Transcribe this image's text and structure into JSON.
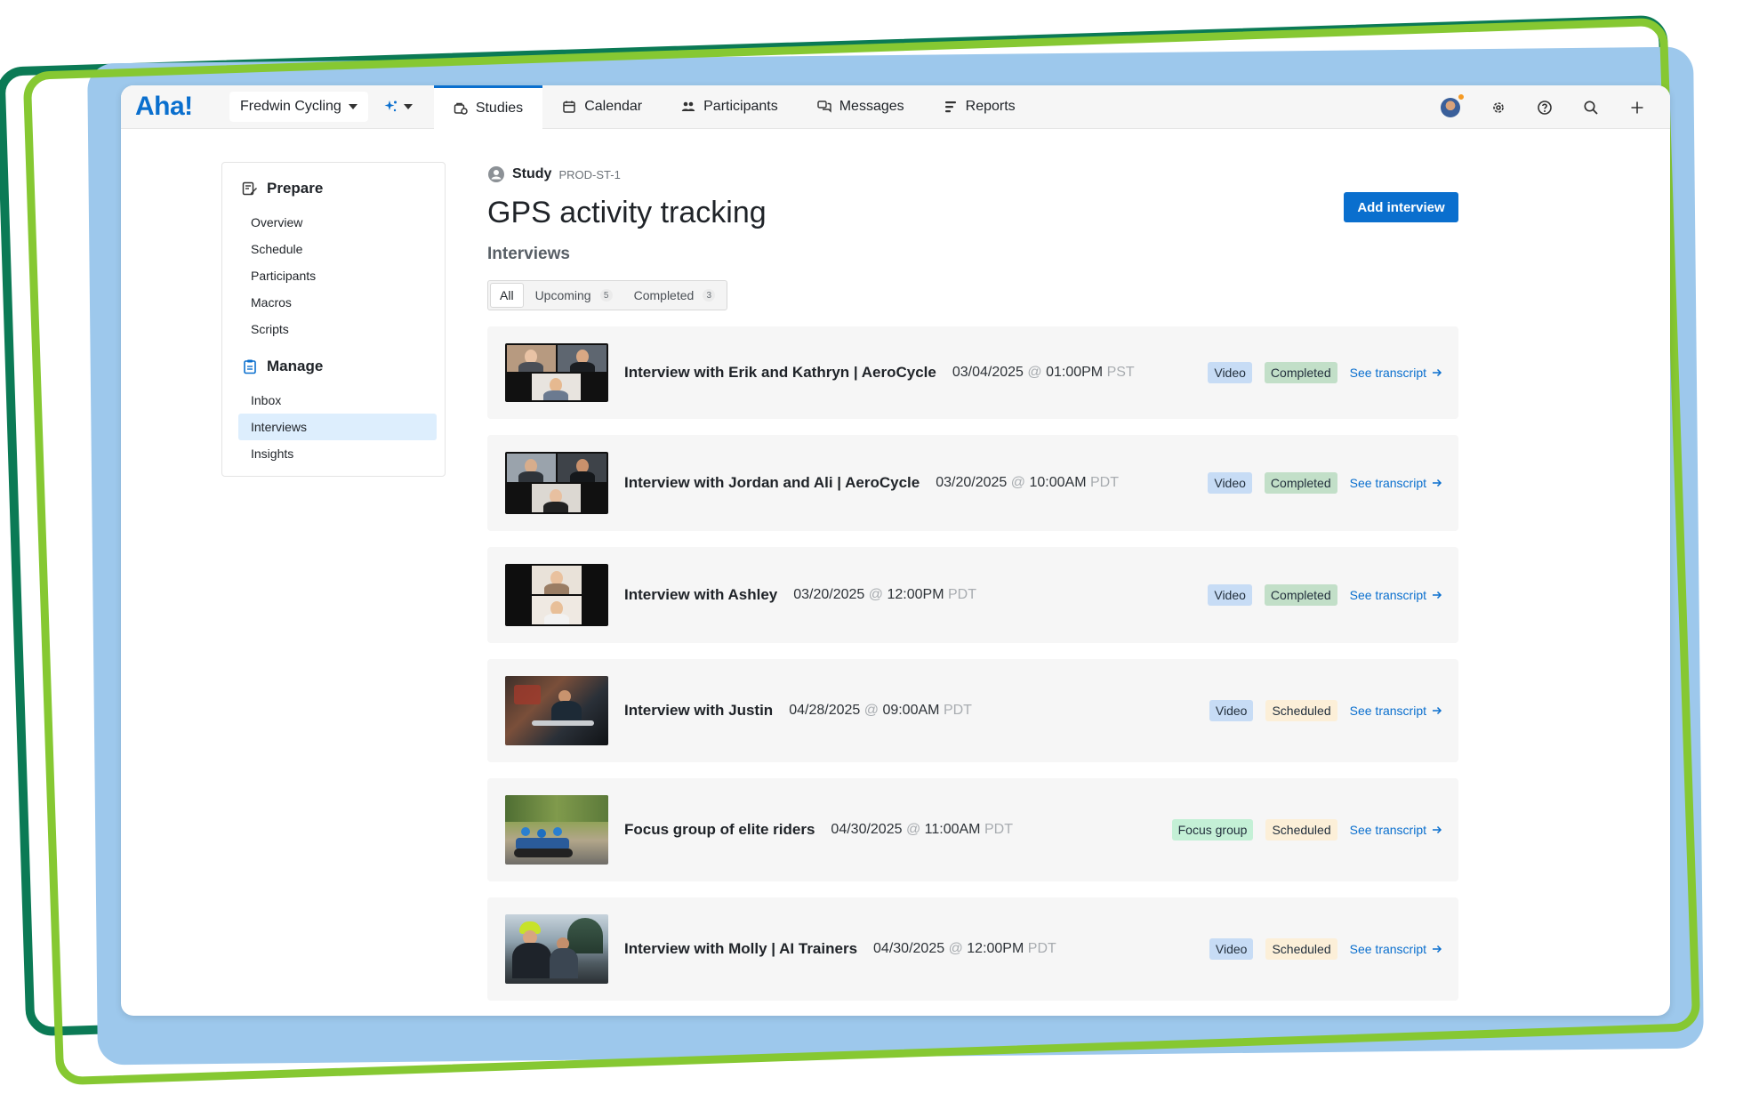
{
  "app": {
    "logo": "Aha!",
    "workspace": "Fredwin Cycling",
    "nav_tabs": [
      {
        "label": "Studies",
        "icon": "studies-icon",
        "active": true
      },
      {
        "label": "Calendar",
        "icon": "calendar-icon",
        "active": false
      },
      {
        "label": "Participants",
        "icon": "participants-icon",
        "active": false
      },
      {
        "label": "Messages",
        "icon": "messages-icon",
        "active": false
      },
      {
        "label": "Reports",
        "icon": "reports-icon",
        "active": false
      }
    ],
    "right_icons": [
      "avatar",
      "gear-icon",
      "help-icon",
      "search-icon",
      "plus-icon"
    ]
  },
  "sidebar": {
    "sections": [
      {
        "label": "Prepare",
        "icon": "prepare-icon",
        "items": [
          "Overview",
          "Schedule",
          "Participants",
          "Macros",
          "Scripts"
        ]
      },
      {
        "label": "Manage",
        "icon": "clipboard-icon",
        "items": [
          "Inbox",
          "Interviews",
          "Insights"
        ]
      }
    ],
    "active_item": "Interviews"
  },
  "study": {
    "label": "Study",
    "id": "PROD-ST-1",
    "title": "GPS activity tracking",
    "subtitle": "Interviews",
    "add_button": "Add interview"
  },
  "filters": [
    {
      "label": "All",
      "count": "",
      "active": true
    },
    {
      "label": "Upcoming",
      "count": "5",
      "active": false
    },
    {
      "label": "Completed",
      "count": "3",
      "active": false
    }
  ],
  "interviews": [
    {
      "title": "Interview with Erik and Kathryn | AeroCycle",
      "date": "03/04/2025",
      "at": "@",
      "time": "01:00PM",
      "tz": "PST",
      "type": "Video",
      "status": "Completed",
      "link": "See transcript"
    },
    {
      "title": "Interview with Jordan and Ali | AeroCycle",
      "date": "03/20/2025",
      "at": "@",
      "time": "10:00AM",
      "tz": "PDT",
      "type": "Video",
      "status": "Completed",
      "link": "See transcript"
    },
    {
      "title": "Interview with Ashley",
      "date": "03/20/2025",
      "at": "@",
      "time": "12:00PM",
      "tz": "PDT",
      "type": "Video",
      "status": "Completed",
      "link": "See transcript"
    },
    {
      "title": "Interview with Justin",
      "date": "04/28/2025",
      "at": "@",
      "time": "09:00AM",
      "tz": "PDT",
      "type": "Video",
      "status": "Scheduled",
      "link": "See transcript"
    },
    {
      "title": "Focus group of elite riders",
      "date": "04/30/2025",
      "at": "@",
      "time": "11:00AM",
      "tz": "PDT",
      "type": "Focus group",
      "status": "Scheduled",
      "link": "See transcript"
    },
    {
      "title": "Interview with Molly | AI Trainers",
      "date": "04/30/2025",
      "at": "@",
      "time": "12:00PM",
      "tz": "PDT",
      "type": "Video",
      "status": "Scheduled",
      "link": "See transcript"
    }
  ],
  "colors": {
    "brand_blue": "#0a6fce",
    "frame_dark_green": "#0b7a55",
    "frame_lime": "#86c832",
    "frame_blue": "#9dc8ec",
    "badge_video": "#c7dcf5",
    "badge_completed": "#c2dfc8",
    "badge_scheduled": "#fcefd8",
    "badge_focus": "#c4f0d6"
  }
}
